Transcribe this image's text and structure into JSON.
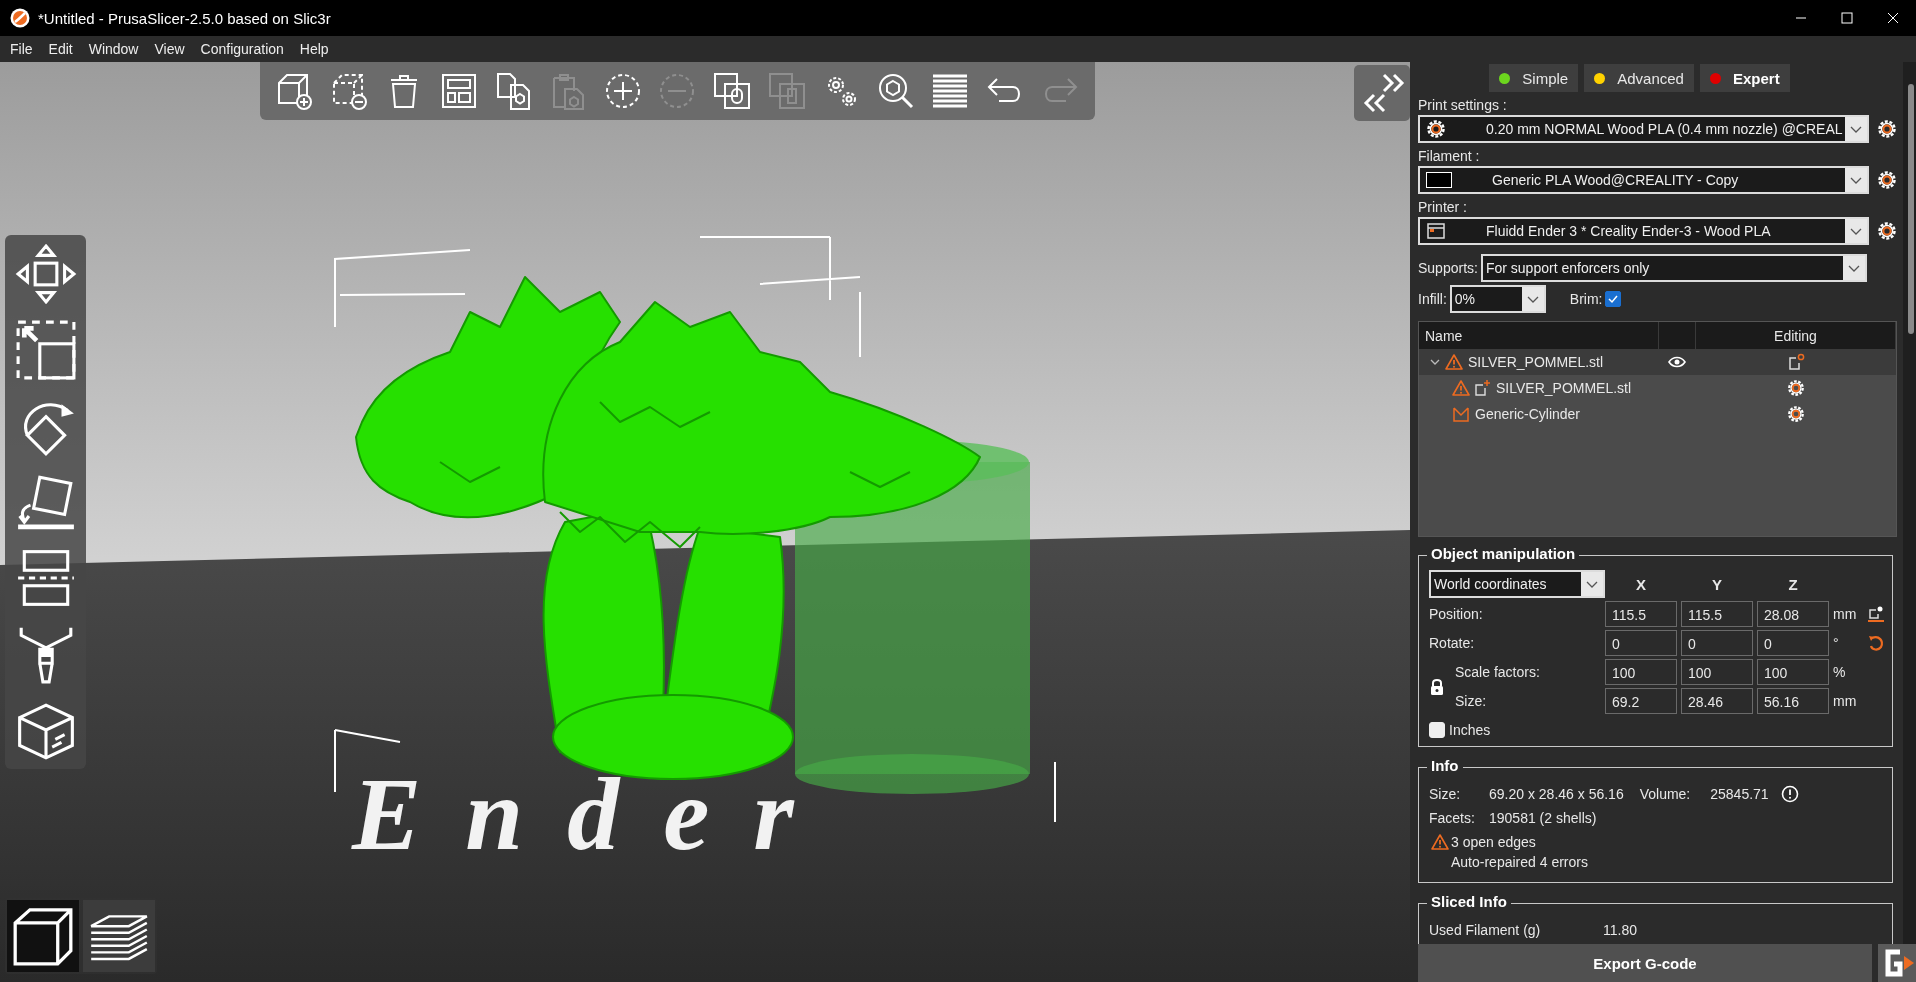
{
  "window": {
    "title": "*Untitled - PrusaSlicer-2.5.0 based on Slic3r"
  },
  "menu": [
    "File",
    "Edit",
    "Window",
    "View",
    "Configuration",
    "Help"
  ],
  "toolbar": [
    {
      "kind": "add",
      "disabled": false
    },
    {
      "kind": "delete",
      "disabled": false
    },
    {
      "kind": "delete_all",
      "disabled": false
    },
    {
      "kind": "arrange",
      "disabled": false
    },
    {
      "kind": "copy",
      "disabled": false
    },
    {
      "kind": "paste",
      "disabled": true
    },
    {
      "kind": "add_instance",
      "disabled": false
    },
    {
      "kind": "remove_instance",
      "disabled": true
    },
    {
      "kind": "split_objects",
      "disabled": false
    },
    {
      "kind": "split_parts",
      "disabled": true
    },
    {
      "kind": "settings",
      "disabled": false
    },
    {
      "kind": "search",
      "disabled": false
    },
    {
      "kind": "layers",
      "disabled": false
    },
    {
      "kind": "undo",
      "disabled": false
    },
    {
      "kind": "redo",
      "disabled": true
    }
  ],
  "view_toggle": [
    {
      "kind": "model",
      "selected": true
    },
    {
      "kind": "preview",
      "selected": false
    }
  ],
  "bed_logo": "Ender",
  "modes": [
    {
      "label": "Simple",
      "color": "#6cd51e",
      "selected": false
    },
    {
      "label": "Advanced",
      "color": "#ffd200",
      "selected": false
    },
    {
      "label": "Expert",
      "color": "#e00000",
      "selected": true
    }
  ],
  "presets": [
    {
      "label": "Print settings :",
      "kind": "print",
      "value": "0.20 mm NORMAL Wood PLA (0.4 mm nozzle) @CREAL"
    },
    {
      "label": "Filament :",
      "kind": "filament",
      "value": "Generic PLA Wood@CREALITY - Copy"
    },
    {
      "label": "Printer :",
      "kind": "printer",
      "value": "Fluidd Ender 3  * Creality Ender-3 - Wood PLA"
    }
  ],
  "supports": {
    "label": "Supports:",
    "value": "For support enforcers only"
  },
  "infill": {
    "label": "Infill:",
    "value": "0%"
  },
  "brim": {
    "label": "Brim:",
    "checked": true
  },
  "object_list": {
    "name_header": "Name",
    "editing_header": "Editing",
    "items": [
      {
        "name": "SILVER_POMMEL.stl",
        "kind": "object",
        "warning": true,
        "expanded": true,
        "selected": true,
        "children": [
          {
            "name": "SILVER_POMMEL.stl",
            "kind": "part",
            "warning": true,
            "selected": false
          },
          {
            "name": "Generic-Cylinder",
            "kind": "modifier",
            "warning": false,
            "selected": false
          }
        ]
      }
    ]
  },
  "object_manipulation": {
    "title": "Object manipulation",
    "coordinates": "World coordinates",
    "axes": [
      "X",
      "Y",
      "Z"
    ],
    "rows": [
      {
        "kind": "position",
        "label": "Position:",
        "values": [
          "115.5",
          "115.5",
          "28.08"
        ],
        "unit": "mm"
      },
      {
        "kind": "rotate",
        "label": "Rotate:",
        "values": [
          "0",
          "0",
          "0"
        ],
        "unit": "°"
      },
      {
        "kind": "scale",
        "label": "Scale factors:",
        "values": [
          "100",
          "100",
          "100"
        ],
        "unit": "%"
      },
      {
        "kind": "size",
        "label": "Size:",
        "values": [
          "69.2",
          "28.46",
          "56.16"
        ],
        "unit": "mm"
      }
    ],
    "inches": {
      "label": "Inches",
      "checked": false
    }
  },
  "info": {
    "title": "Info",
    "size_label": "Size:",
    "size": "69.20 x 28.46 x 56.16",
    "volume_label": "Volume:",
    "volume": "25845.71",
    "facets_label": "Facets:",
    "facets": "190581 (2 shells)",
    "warning": "3 open edges",
    "repaired": "Auto-repaired 4 errors"
  },
  "sliced_info": {
    "title": "Sliced Info",
    "rows": [
      {
        "label": "Used Filament (g)",
        "value": "11.80"
      }
    ]
  },
  "export_button": "Export G-code"
}
